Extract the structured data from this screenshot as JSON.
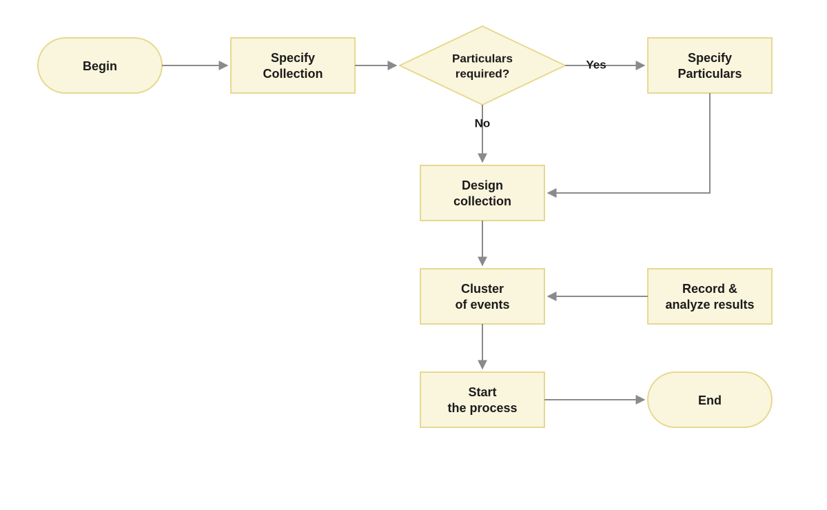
{
  "nodes": {
    "begin": {
      "label": "Begin"
    },
    "specify_collection": {
      "line1": "Specify",
      "line2": "Collection"
    },
    "decision": {
      "line1": "Particulars",
      "line2": "required?"
    },
    "specify_particulars": {
      "line1": "Specify",
      "line2": "Particulars"
    },
    "design_collection": {
      "line1": "Design",
      "line2": "collection"
    },
    "cluster_events": {
      "line1": "Cluster",
      "line2": "of events"
    },
    "record_analyze": {
      "line1": "Record &",
      "line2": "analyze results"
    },
    "start_process": {
      "line1": "Start",
      "line2": "the process"
    },
    "end": {
      "label": "End"
    }
  },
  "edges": {
    "yes": "Yes",
    "no": "No"
  },
  "colors": {
    "node_fill": "#faf5dd",
    "node_stroke": "#e6d98f",
    "arrow": "#8a8a8a"
  }
}
